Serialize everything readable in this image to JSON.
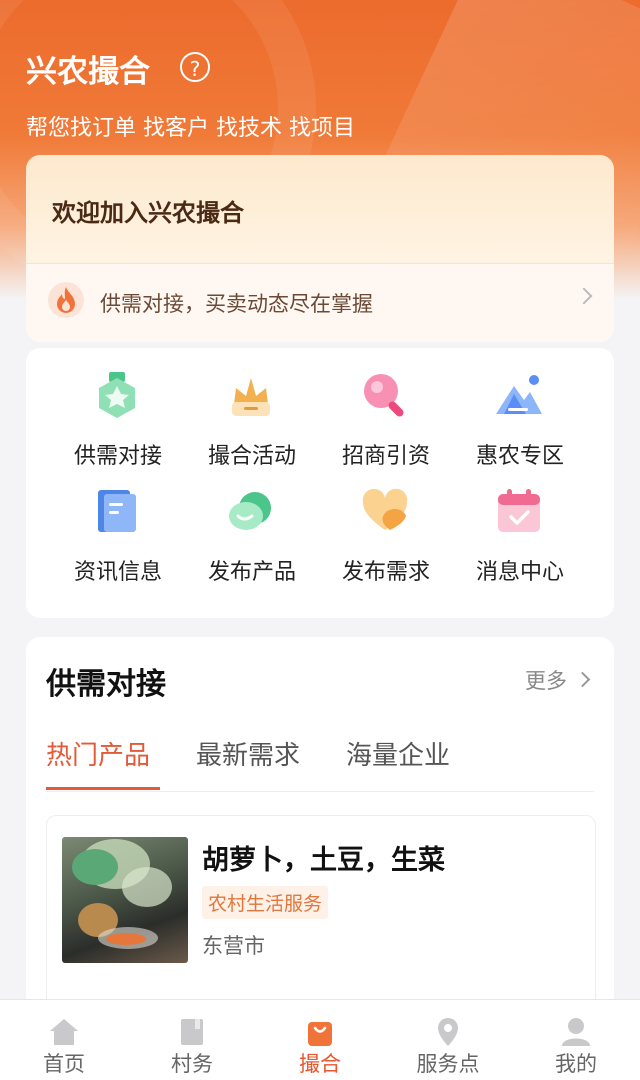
{
  "header": {
    "title": "兴农撮合",
    "help_icon": "question-circle-icon",
    "subtitle": "帮您找订单 找客户 找技术 找项目"
  },
  "welcome": {
    "text": "欢迎加入兴农撮合",
    "banner_text": "供需对接，买卖动态尽在掌握",
    "banner_icon": "fire-icon"
  },
  "grid": {
    "items": [
      {
        "label": "供需对接",
        "icon": "medal-icon"
      },
      {
        "label": "撮合活动",
        "icon": "crown-icon"
      },
      {
        "label": "招商引资",
        "icon": "magnifier-icon"
      },
      {
        "label": "惠农专区",
        "icon": "mountain-icon"
      },
      {
        "label": "资讯信息",
        "icon": "document-icon"
      },
      {
        "label": "发布产品",
        "icon": "cloud-chat-icon"
      },
      {
        "label": "发布需求",
        "icon": "heart-icon"
      },
      {
        "label": "消息中心",
        "icon": "calendar-icon"
      }
    ]
  },
  "section": {
    "title": "供需对接",
    "more": "更多",
    "tabs": [
      "热门产品",
      "最新需求",
      "海量企业"
    ],
    "active_tab": 0
  },
  "products": [
    {
      "title": "胡萝卜，土豆，生菜",
      "tag": "农村生活服务",
      "location": "东营市"
    }
  ],
  "nav": {
    "items": [
      {
        "label": "首页",
        "icon": "home-icon"
      },
      {
        "label": "村务",
        "icon": "book-icon"
      },
      {
        "label": "撮合",
        "icon": "shopping-bag-icon"
      },
      {
        "label": "服务点",
        "icon": "map-pin-icon"
      },
      {
        "label": "我的",
        "icon": "user-icon"
      }
    ],
    "active": 2
  },
  "colors": {
    "brand": "#ec6b2d",
    "accent": "#e35a3a",
    "tag": "#e3763b"
  }
}
